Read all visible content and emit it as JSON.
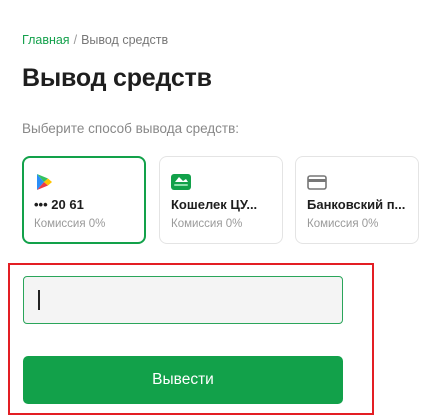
{
  "breadcrumb": {
    "home": "Главная",
    "separator": "/",
    "current": "Вывод средств"
  },
  "page": {
    "title": "Вывод средств",
    "subtitle": "Выберите способ вывода средств:"
  },
  "methods": [
    {
      "icon": "google-play-icon",
      "title": "••• 20 61",
      "fee": "Комиссия 0%",
      "selected": true
    },
    {
      "icon": "wallet-icon",
      "title": "Кошелек ЦУ...",
      "fee": "Комиссия 0%",
      "selected": false
    },
    {
      "icon": "card-icon",
      "title": "Банковский п...",
      "fee": "Комиссия 0%",
      "selected": false
    }
  ],
  "form": {
    "amount_value": "",
    "submit_label": "Вывести"
  },
  "colors": {
    "accent": "#12a14a",
    "highlight": "#e31e24"
  }
}
